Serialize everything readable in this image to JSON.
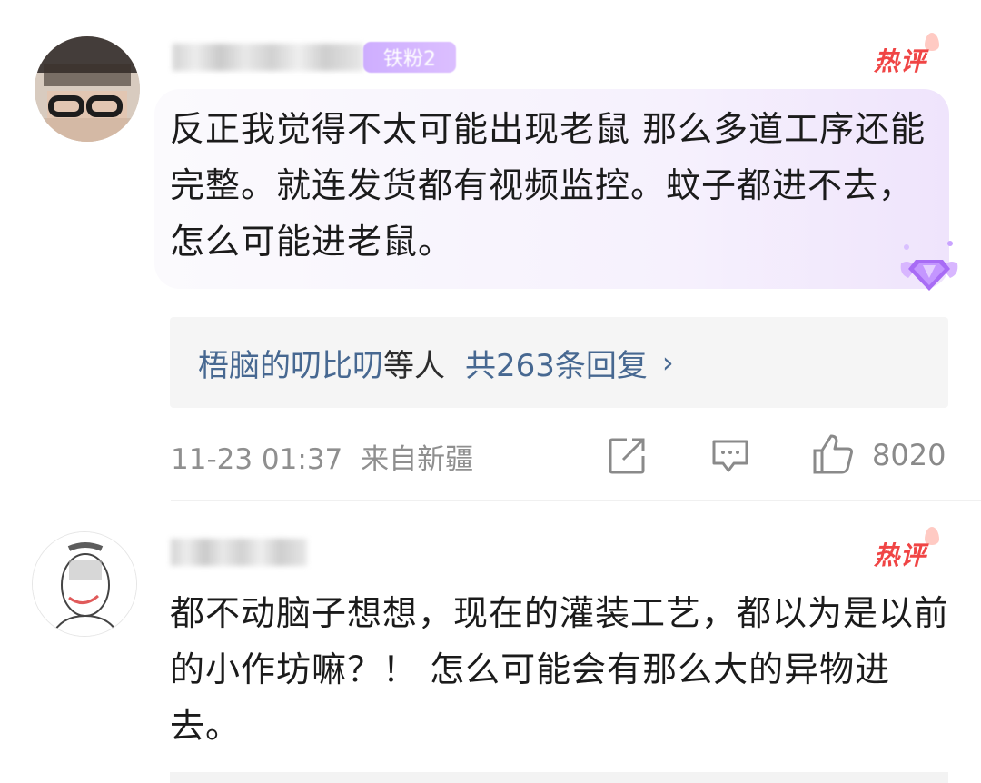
{
  "comments": [
    {
      "fan_badge": "铁粉2",
      "hot_label": "热评",
      "text": "反正我觉得不太可能出现老鼠 那么多道工序还能完整。就连发货都有视频监控。蚊子都进不去，怎么可能进老鼠。",
      "replies": {
        "names": "梧脑的叨比叨",
        "mid": "等人",
        "count": "共263条回复"
      },
      "timestamp": "11-23 01:37",
      "location": "来自新疆",
      "likes": "8020"
    },
    {
      "hot_label": "热评",
      "text": "都不动脑子想想，现在的灌装工艺，都以为是以前的小作坊嘛？！ 怎么可能会有那么大的异物进去。"
    }
  ],
  "icons": {
    "share": "share-icon",
    "comment": "comment-icon",
    "like": "thumbs-up-icon",
    "chevron": "chevron-right-icon",
    "gem": "gem-icon"
  },
  "colors": {
    "hot": "#f04545",
    "link": "#476891",
    "bubble": "#f6f1fd"
  }
}
